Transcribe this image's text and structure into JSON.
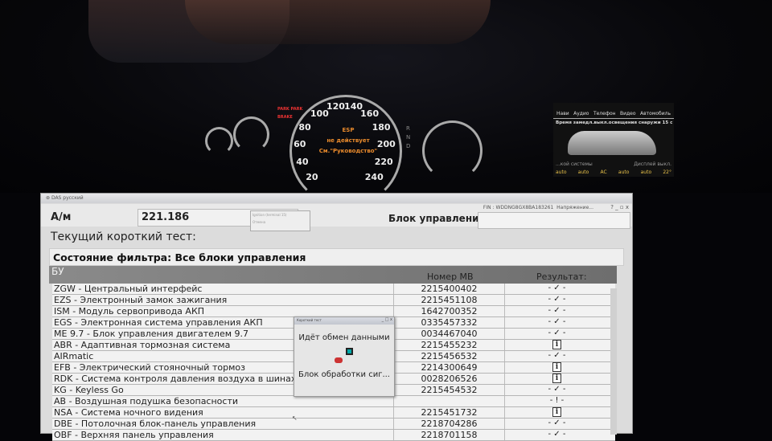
{
  "dashboard": {
    "speedo_ticks": [
      "20",
      "40",
      "60",
      "80",
      "100",
      "120",
      "140",
      "160",
      "180",
      "200",
      "220",
      "240"
    ],
    "warning": [
      "ESP",
      "не действует",
      "См.\"Руководство\""
    ],
    "park_labels": [
      "PARK PARK",
      "BRAKE"
    ],
    "gears": [
      "R",
      "N",
      "D"
    ],
    "comand": {
      "menu": [
        "Нави",
        "Аудио",
        "Телефон",
        "Видео",
        "Автомобиль"
      ],
      "info": "Время замедл.выкл.освещения снаружи 15 с",
      "system": "...кой системы",
      "display_off": "Дисплей выкл.",
      "bottom": [
        "auto",
        "auto",
        "AC",
        "auto",
        "auto",
        "22°"
      ]
    }
  },
  "app": {
    "title": "DAS русский",
    "vehicle_label": "А/м",
    "vehicle_value": "221.186",
    "popup_title": "Ignition (terminal 15)",
    "popup_item": "Отмена",
    "fin": "FIN : WDDNG8GX8BA183261",
    "voltage": "Напряжение...",
    "window_buttons": "? _ ▫ x",
    "control_unit_label": "Блок управления",
    "current_test": "Текущий короткий тест:",
    "filter_state": "Состояние фильтра: Все блоки управления",
    "bu_header": "БУ",
    "col_number": "Номер MB",
    "col_result": "Результат:"
  },
  "rows": [
    {
      "name": "ZGW - Центральный интерфейс",
      "number": "2215400402",
      "result": "check"
    },
    {
      "name": "EZS - Электронный замок зажигания",
      "number": "2215451108",
      "result": "check"
    },
    {
      "name": "ISM - Модуль сервопривода АКП",
      "number": "1642700352",
      "result": "check"
    },
    {
      "name": "EGS - Электронная система управления АКП",
      "number": "0335457332",
      "result": "check"
    },
    {
      "name": "ME 9.7 - Блок управления двигателем 9.7",
      "number": "0034467040",
      "result": "check"
    },
    {
      "name": "ABR - Адаптивная тормозная система",
      "number": "2215455232",
      "result": "info"
    },
    {
      "name": "AIRmatic",
      "number": "2215456532",
      "result": "check"
    },
    {
      "name": "EFB - Электрический стояночный тормоз",
      "number": "2214300649",
      "result": "info"
    },
    {
      "name": "RDK - Система контроля давления воздуха в шинах",
      "number": "0028206526",
      "result": "info"
    },
    {
      "name": "KG - Keyless Go",
      "number": "2215454532",
      "result": "check"
    },
    {
      "name": "AB - Воздушная подушка безопасности",
      "number": "",
      "result": "warn"
    },
    {
      "name": "NSA - Система ночного видения",
      "number": "2215451732",
      "result": "info"
    },
    {
      "name": "DBE - Потолочная блок-панель управления",
      "number": "2218704286",
      "result": "check"
    },
    {
      "name": "OBF - Верхняя панель управления",
      "number": "2218701158",
      "result": "check"
    }
  ],
  "symbols": {
    "check": "- ✓ -",
    "info": "i",
    "warn": "- ! -"
  },
  "dialog": {
    "title": "Короткий тест",
    "buttons": "_ □ x",
    "status": "Идёт обмен данными",
    "unit": "Блок обработки сиг..."
  }
}
